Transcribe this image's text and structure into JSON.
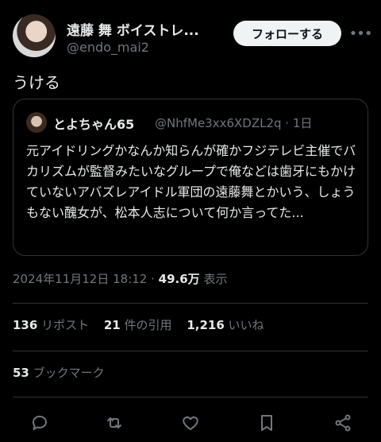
{
  "author": {
    "name": "遠藤 舞 ボイストレ...",
    "handle": "@endo_mai2",
    "follow_label": "フォローする",
    "more_icon": "more-icon"
  },
  "tweet": {
    "text": "うける"
  },
  "quote": {
    "name": "とよちゃん65",
    "handle": "@NhfMe3xx6XDZL2q · 1日",
    "body": "元アイドリングかなんか知らんが確かフジテレビ主催でバカリズムが監督みたいなグループで俺などは歯牙にもかけていないアバズレアイドル軍団の遠藤舞とかいう、しょうもない醜女が、松本人志について何か言ってた..."
  },
  "meta": {
    "datetime": "2024年11月12日 18:12 · ",
    "views": "49.6万",
    "views_label": " 表示"
  },
  "stats": {
    "reposts_count": "136",
    "reposts_label": " リポスト",
    "quotes_count": "21",
    "quotes_label": " 件の引用",
    "likes_count": "1,216",
    "likes_label": " いいね",
    "bookmarks_count": "53",
    "bookmarks_label": " ブックマーク"
  },
  "actions": [
    "reply-icon",
    "repost-icon",
    "like-icon",
    "bookmark-icon",
    "share-icon"
  ]
}
